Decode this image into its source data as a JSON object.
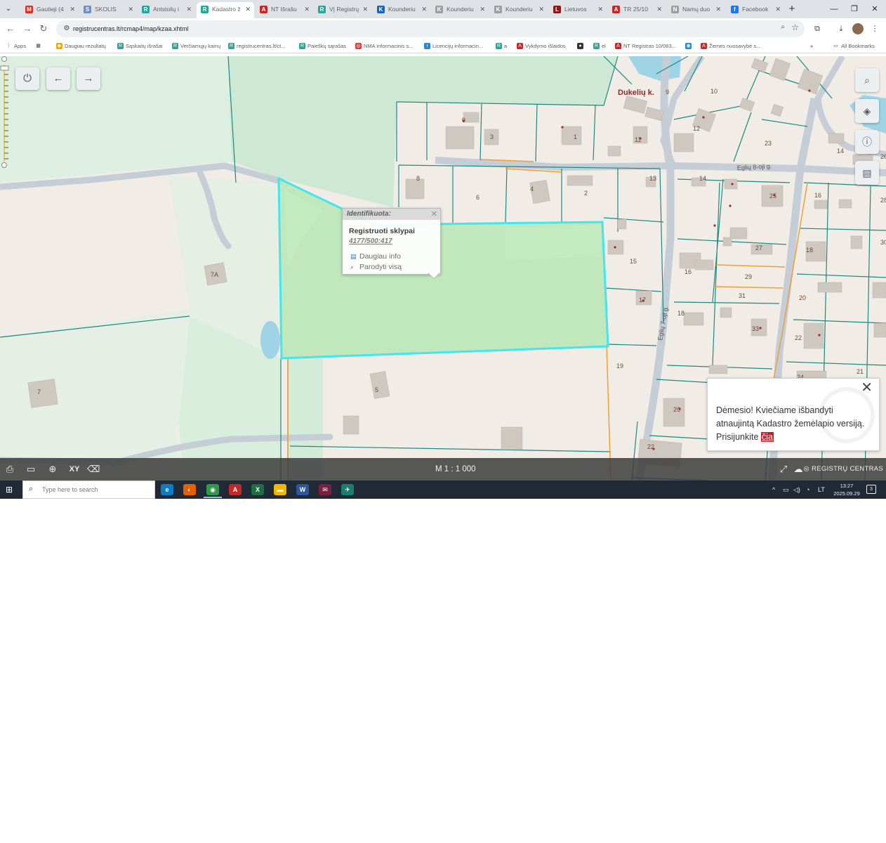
{
  "browser": {
    "tabs": [
      {
        "label": "Gautieji (4",
        "icon": "gmail-icon",
        "color": "#d93025",
        "glyph": "M"
      },
      {
        "label": "SKOLIS",
        "icon": "cloud-icon",
        "color": "#6f8fbf",
        "glyph": "S"
      },
      {
        "label": "Antstolių i",
        "icon": "registrucentras-icon",
        "color": "#26a69a",
        "glyph": "R"
      },
      {
        "label": "Kadastro ž",
        "icon": "registrucentras-icon",
        "color": "#26a69a",
        "glyph": "R"
      },
      {
        "label": "NT Išrašu",
        "icon": "pdf-icon",
        "color": "#c62828",
        "glyph": "A"
      },
      {
        "label": "VĮ Registrų",
        "icon": "registrucentras-icon",
        "color": "#26a69a",
        "glyph": "R"
      },
      {
        "label": "Kounderiu",
        "icon": "kounderiu-icon",
        "color": "#1565c0",
        "glyph": "K"
      },
      {
        "label": "Kounderiu",
        "icon": "kounderiu-icon",
        "color": "#9e9e9e",
        "glyph": "K"
      },
      {
        "label": "Kounderiu",
        "icon": "kounderiu-icon",
        "color": "#9e9e9e",
        "glyph": "K"
      },
      {
        "label": "Lietuvos",
        "icon": "lietuvos-icon",
        "color": "#8b1a1a",
        "glyph": "L"
      },
      {
        "label": "TR 25/10",
        "icon": "pdf-icon",
        "color": "#c62828",
        "glyph": "A"
      },
      {
        "label": "Namų duo",
        "icon": "globe-icon",
        "color": "#9e9e9e",
        "glyph": "N"
      },
      {
        "label": "Facebook",
        "icon": "facebook-icon",
        "color": "#1877f2",
        "glyph": "f"
      }
    ],
    "active_tab": 3,
    "url": "registrucentras.lt/rcmap4/map/kzaa.xhtml",
    "bookmarks": [
      {
        "label": "Apps",
        "color": "#555555",
        "glyph": "⋮"
      },
      {
        "label": "",
        "color": "#555555",
        "glyph": "▦"
      },
      {
        "label": "Daugiau rezultatų",
        "color": "#f2a900",
        "glyph": "◆"
      },
      {
        "label": "Sąskaitų išrašai",
        "color": "#26a69a",
        "glyph": "R"
      },
      {
        "label": "Verčiamųjų kainų",
        "color": "#26a69a",
        "glyph": "R"
      },
      {
        "label": "registrucentras.lt/ct...",
        "color": "#26a69a",
        "glyph": "R"
      },
      {
        "label": "Paieškų sąrašas",
        "color": "#26a69a",
        "glyph": "R"
      },
      {
        "label": "NMA informacinis s...",
        "color": "#e53935",
        "glyph": "◎"
      },
      {
        "label": "Licencijų informacin...",
        "color": "#1e88e5",
        "glyph": "i"
      },
      {
        "label": "a",
        "color": "#26a69a",
        "glyph": "R"
      },
      {
        "label": "Vykdymo išlaidos",
        "color": "#c62828",
        "glyph": "A"
      },
      {
        "label": "",
        "color": "#333333",
        "glyph": "●"
      },
      {
        "label": "el",
        "color": "#26a69a",
        "glyph": "R"
      },
      {
        "label": "NT Registras 10/083...",
        "color": "#c62828",
        "glyph": "A"
      },
      {
        "label": "",
        "color": "#1e88e5",
        "glyph": "◉"
      },
      {
        "label": "Žemės nuosavybė s...",
        "color": "#c62828",
        "glyph": "A"
      }
    ],
    "all_bookmarks": "All Bookmarks"
  },
  "map": {
    "popup": {
      "header": "Identifikuota:",
      "title": "Registruoti sklypai",
      "id": "4177/500:417",
      "more_info": "Daugiau info",
      "show_all": "Parodyti visą"
    },
    "labels": [
      {
        "text": "Dukelių k.",
        "cls": "village"
      },
      {
        "text": "Eglių 8-oji g.",
        "cls": "street"
      },
      {
        "text": "Eglių 7-oji g.",
        "cls": "street"
      },
      {
        "text": "7A"
      },
      {
        "text": "7"
      },
      {
        "text": "5"
      },
      {
        "text": "9"
      },
      {
        "text": "3"
      },
      {
        "text": "1"
      },
      {
        "text": "11"
      },
      {
        "text": "8"
      },
      {
        "text": "6"
      },
      {
        "text": "4"
      },
      {
        "text": "2"
      },
      {
        "text": "13"
      },
      {
        "text": "15"
      },
      {
        "text": "17"
      },
      {
        "text": "19"
      },
      {
        "text": "9"
      },
      {
        "text": "10"
      },
      {
        "text": "12"
      },
      {
        "text": "23"
      },
      {
        "text": "14"
      },
      {
        "text": "25"
      },
      {
        "text": "27"
      },
      {
        "text": "29"
      },
      {
        "text": "31"
      },
      {
        "text": "33"
      },
      {
        "text": "16"
      },
      {
        "text": "18"
      },
      {
        "text": "20"
      },
      {
        "text": "22"
      },
      {
        "text": "14"
      },
      {
        "text": "16"
      },
      {
        "text": "18"
      },
      {
        "text": "20"
      },
      {
        "text": "22"
      },
      {
        "text": "24"
      },
      {
        "text": "21"
      },
      {
        "text": "26"
      },
      {
        "text": "28"
      },
      {
        "text": "30"
      }
    ],
    "notice": {
      "text_before": "Dėmesio! Kviečiame išbandyti atnaujintą Kadastro žemėlapio versiją. Prisijunkite",
      "link": "čia"
    },
    "scale": "M 1 : 1 000",
    "brand": "REGISTRŲ CENTRAS"
  },
  "taskbar": {
    "search_placeholder": "Type here to search",
    "time": "13:27",
    "date": "2025.09.29",
    "lang": "LT",
    "notif_count": "3",
    "apps": [
      {
        "name": "edge-icon",
        "color": "#0f7cbf",
        "glyph": "e"
      },
      {
        "name": "firefox-icon",
        "color": "#e66000",
        "glyph": "◐"
      },
      {
        "name": "chrome-icon",
        "color": "#2e9a47",
        "glyph": "◉"
      },
      {
        "name": "acrobat-icon",
        "color": "#c62828",
        "glyph": "A"
      },
      {
        "name": "excel-icon",
        "color": "#1d6f42",
        "glyph": "X"
      },
      {
        "name": "explorer-icon",
        "color": "#f2b705",
        "glyph": "▬"
      },
      {
        "name": "word-icon",
        "color": "#2b579a",
        "glyph": "W"
      },
      {
        "name": "app-icon",
        "color": "#7a1f3d",
        "glyph": "✉"
      },
      {
        "name": "app2-icon",
        "color": "#1a7f6e",
        "glyph": "✈"
      }
    ]
  },
  "colors": {
    "parcel_fill": "#b9e6b5",
    "parcel_border": "#44e6ee",
    "lot_border": "#1a8a80",
    "road": "#c5cdd6",
    "forest": "#d3ecd9",
    "orange_border": "#f0a030"
  }
}
